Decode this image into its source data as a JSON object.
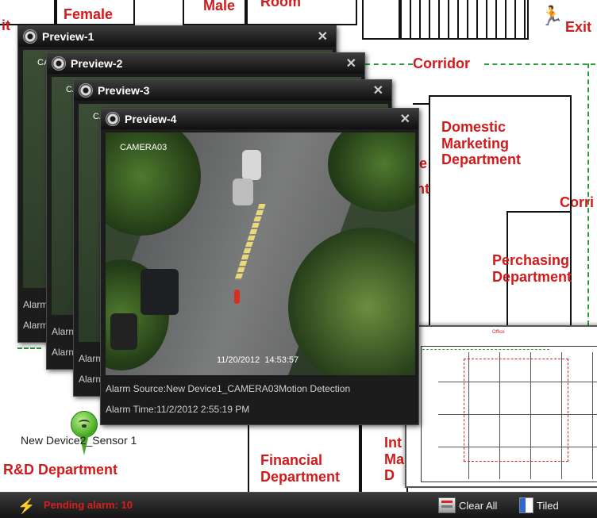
{
  "floorplan": {
    "rooms": {
      "female": "Female",
      "male": "Male",
      "room": "Room",
      "exit": "Exit",
      "corridor": "Corridor",
      "corridor_right": "Corri",
      "domestic": "Domestic\nMarketing\nDepartment",
      "perchasing": "Perchasing\nDepartment",
      "rd": "R&D Department",
      "financial": "Financial\nDepartment",
      "int": "Int\nMa\nD",
      "left_cut": "it",
      "mid_cut1": "e",
      "mid_cut2": "nt"
    },
    "sensor_label": "New Device2_Sensor 1"
  },
  "windows": [
    {
      "title": "Preview-1",
      "close": "✕",
      "cam_label": "CA",
      "info1": "Alarm",
      "info2": "Alarm"
    },
    {
      "title": "Preview-2",
      "close": "✕",
      "cam_label": "CA",
      "info1": "Alarm",
      "info2": "Alarm"
    },
    {
      "title": "Preview-3",
      "close": "✕",
      "cam_label": "CA",
      "info1": "Alarm",
      "info2": "Alarm"
    },
    {
      "title": "Preview-4",
      "close": "✕",
      "cam_label": "CAMERA03",
      "timestamp": "11/20/2012  14:53:57",
      "info1": "Alarm Source:New Device1_CAMERA03Motion Detection",
      "info2": "Alarm Time:11/2/2012 2:55:19 PM"
    }
  ],
  "minimap": {
    "top_label": "Office"
  },
  "statusbar": {
    "pending": "Pending alarm: 10",
    "clear_all": "Clear All",
    "tiled": "Tiled"
  },
  "colors": {
    "alarm_red": "#d81f1f",
    "corridor_green": "#2e9b3a",
    "label_red": "#d21a1a"
  },
  "icons": [
    "camera-icon",
    "close-icon",
    "exit-sign-icon",
    "sensor-pin-icon",
    "alarm-icon",
    "clear-all-icon",
    "tiled-icon"
  ]
}
